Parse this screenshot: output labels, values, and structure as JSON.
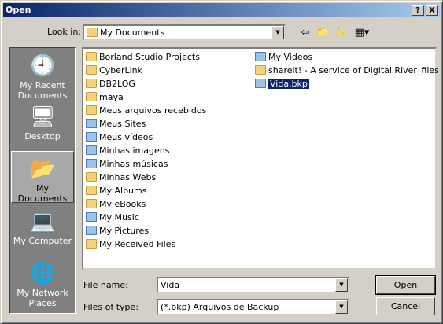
{
  "window": {
    "title": "Open"
  },
  "titlebar": {
    "help": "?",
    "close": "X"
  },
  "lookin": {
    "label": "Look in:",
    "value": "My Documents",
    "icon": "my-documents-icon"
  },
  "toolbar": {
    "back_icon": "back-arrow-icon",
    "up_icon": "up-folder-icon",
    "new_icon": "new-folder-icon",
    "view_icon": "view-menu-icon"
  },
  "places": [
    {
      "label": "My Recent Documents",
      "icon": "recent-documents-icon",
      "selected": false
    },
    {
      "label": "Desktop",
      "icon": "desktop-icon",
      "selected": false
    },
    {
      "label": "My Documents",
      "icon": "my-documents-icon",
      "selected": true
    },
    {
      "label": "My Computer",
      "icon": "my-computer-icon",
      "selected": false
    },
    {
      "label": "My Network Places",
      "icon": "network-places-icon",
      "selected": false
    }
  ],
  "files": {
    "col1": [
      {
        "name": "Borland Studio Projects",
        "type": "folder"
      },
      {
        "name": "CyberLink",
        "type": "folder"
      },
      {
        "name": "DB2LOG",
        "type": "folder"
      },
      {
        "name": "maya",
        "type": "folder"
      },
      {
        "name": "Meus arquivos recebidos",
        "type": "folder"
      },
      {
        "name": "Meus Sites",
        "type": "special"
      },
      {
        "name": "Meus vídeos",
        "type": "special"
      },
      {
        "name": "Minhas imagens",
        "type": "special"
      },
      {
        "name": "Minhas músicas",
        "type": "special"
      },
      {
        "name": "Minhas Webs",
        "type": "folder"
      },
      {
        "name": "My Albums",
        "type": "folder"
      },
      {
        "name": "My eBooks",
        "type": "folder"
      },
      {
        "name": "My Music",
        "type": "special"
      },
      {
        "name": "My Pictures",
        "type": "special"
      },
      {
        "name": "My Received Files",
        "type": "folder"
      }
    ],
    "col2": [
      {
        "name": "My Videos",
        "type": "special",
        "selected": false
      },
      {
        "name": "shareit! - A service of Digital River_files",
        "type": "folder",
        "selected": false
      },
      {
        "name": "Vida.bkp",
        "type": "file",
        "selected": true
      }
    ]
  },
  "filename": {
    "label": "File name:",
    "value": "Vida"
  },
  "filetype": {
    "label": "Files of type:",
    "value": "(*.bkp) Arquivos de Backup"
  },
  "buttons": {
    "open": "Open",
    "cancel": "Cancel"
  }
}
